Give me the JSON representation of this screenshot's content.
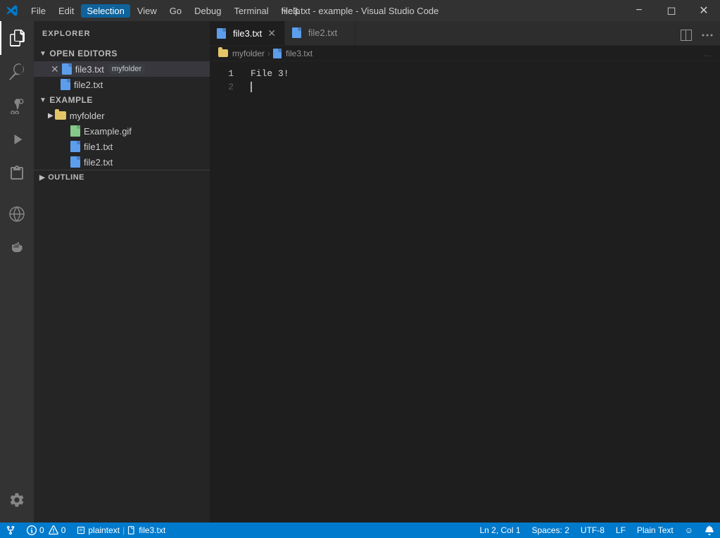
{
  "titleBar": {
    "title": "file3.txt - example - Visual Studio Code",
    "menuItems": [
      "File",
      "Edit",
      "Selection",
      "View",
      "Go",
      "Debug",
      "Terminal",
      "Help"
    ],
    "activeMenu": "Selection"
  },
  "activityBar": {
    "items": [
      {
        "name": "explorer",
        "tooltip": "Explorer"
      },
      {
        "name": "search",
        "tooltip": "Search"
      },
      {
        "name": "source-control",
        "tooltip": "Source Control"
      },
      {
        "name": "run",
        "tooltip": "Run"
      },
      {
        "name": "extensions",
        "tooltip": "Extensions"
      },
      {
        "name": "remote-explorer",
        "tooltip": "Remote Explorer"
      },
      {
        "name": "docker",
        "tooltip": "Docker"
      }
    ],
    "bottomItems": [
      {
        "name": "settings",
        "tooltip": "Settings"
      }
    ],
    "activeItem": "explorer"
  },
  "sidebar": {
    "title": "Explorer",
    "openEditors": {
      "label": "Open Editors",
      "items": [
        {
          "name": "file3.txt",
          "context": "myfolder",
          "active": true
        },
        {
          "name": "file2.txt",
          "context": ""
        }
      ]
    },
    "example": {
      "label": "Example",
      "children": [
        {
          "name": "myfolder",
          "type": "folder",
          "children": [
            {
              "name": "Example.gif",
              "type": "gif"
            },
            {
              "name": "file1.txt",
              "type": "txt"
            },
            {
              "name": "file2.txt",
              "type": "txt"
            }
          ]
        }
      ]
    },
    "outline": {
      "label": "Outline"
    }
  },
  "tabs": [
    {
      "label": "file3.txt",
      "active": true,
      "dirty": false
    },
    {
      "label": "file2.txt",
      "active": false,
      "dirty": false
    }
  ],
  "breadcrumb": {
    "parts": [
      "myfolder",
      "file3.txt"
    ]
  },
  "editor": {
    "lines": [
      {
        "num": 1,
        "content": "File 3!"
      },
      {
        "num": 2,
        "content": ""
      }
    ],
    "cursorLine": 2,
    "cursorCol": 1
  },
  "statusBar": {
    "left": [
      {
        "icon": "git-icon",
        "text": "0"
      },
      {
        "icon": "warning-icon",
        "text": "0"
      }
    ],
    "fileInfo": "plaintext | file3.txt",
    "right": [
      {
        "text": "Ln 2, Col 1",
        "name": "cursor-position"
      },
      {
        "text": "Spaces: 2",
        "name": "indentation"
      },
      {
        "text": "UTF-8",
        "name": "encoding"
      },
      {
        "text": "LF",
        "name": "line-endings"
      },
      {
        "text": "Plain Text",
        "name": "language-mode"
      }
    ],
    "smiley": "☺",
    "bell": "🔔"
  }
}
